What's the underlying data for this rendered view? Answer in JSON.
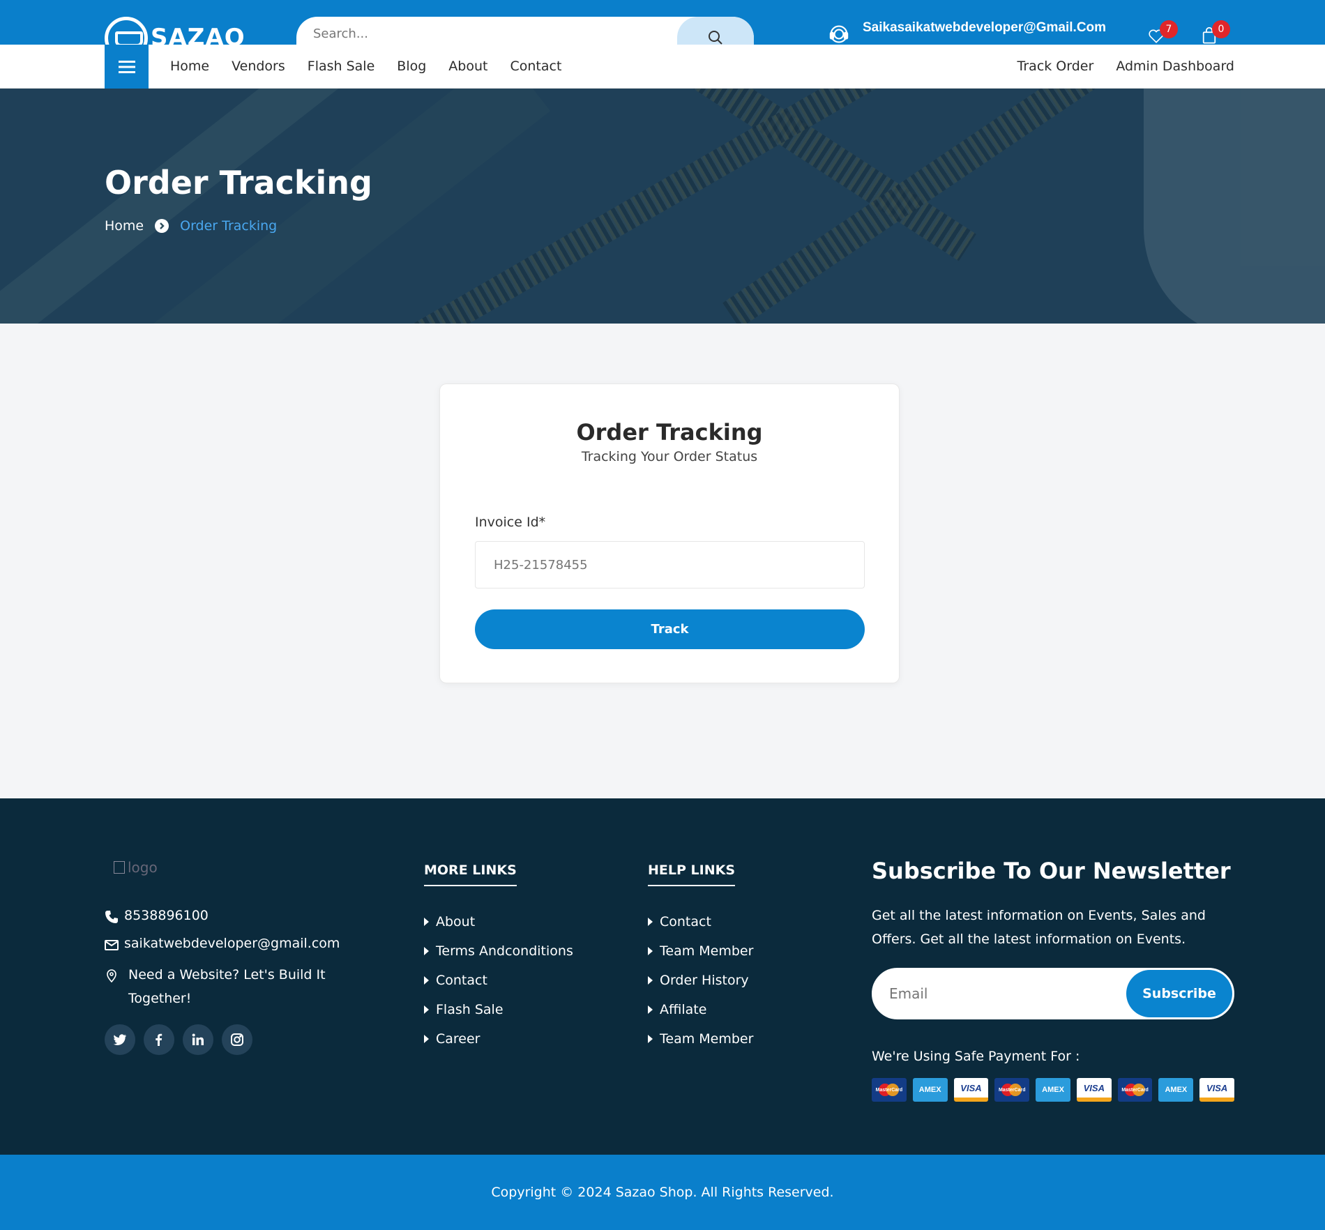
{
  "brand": {
    "name": "SAZAO",
    "primary_color": "#0a7fcb",
    "footer_color": "#0b2a3c"
  },
  "header": {
    "search_placeholder": "Search...",
    "email": "Saikasaikatwebdeveloper@Gmail.Com",
    "wishlist_count": "7",
    "cart_count": "0"
  },
  "nav": {
    "left": [
      "Home",
      "Vendors",
      "Flash Sale",
      "Blog",
      "About",
      "Contact"
    ],
    "right": [
      "Track Order",
      "Admin Dashboard"
    ]
  },
  "hero": {
    "title": "Order Tracking",
    "breadcrumb_home": "Home",
    "breadcrumb_current": "Order Tracking"
  },
  "tracking": {
    "title": "Order Tracking",
    "subtitle": "Tracking Your Order Status",
    "invoice_label": "Invoice Id*",
    "invoice_placeholder": "H25-21578455",
    "button": "Track"
  },
  "footer": {
    "logo_alt": "logo",
    "phone": "8538896100",
    "email": "saikatwebdeveloper@gmail.com",
    "address": "Need a Website? Let's Build It Together!",
    "more_links_title": "MORE LINKS",
    "more_links": [
      "About",
      "Terms Andconditions",
      "Contact",
      "Flash Sale",
      "Career"
    ],
    "help_links_title": "HELP LINKS",
    "help_links": [
      "Contact",
      "Team Member",
      "Order History",
      "Affilate",
      "Team Member"
    ],
    "newsletter_title": "Subscribe To Our Newsletter",
    "newsletter_text": "Get all the latest information on Events, Sales and Offers. Get all the latest information on Events.",
    "newsletter_placeholder": "Email",
    "subscribe_button": "Subscribe",
    "payment_label": "We're Using Safe Payment For :",
    "payment_methods": [
      {
        "type": "mc",
        "label": "MasterCard"
      },
      {
        "type": "amex",
        "label": "AMEX"
      },
      {
        "type": "visa",
        "label": "VISA"
      },
      {
        "type": "mc",
        "label": "MasterCard"
      },
      {
        "type": "amex",
        "label": "AMEX"
      },
      {
        "type": "visa",
        "label": "VISA"
      },
      {
        "type": "mc",
        "label": "MasterCard"
      },
      {
        "type": "amex",
        "label": "AMEX"
      },
      {
        "type": "visa",
        "label": "VISA"
      }
    ],
    "social_icons": [
      "twitter-icon",
      "facebook-icon",
      "linkedin-icon",
      "instagram-icon"
    ],
    "copyright": "Copyright © 2024 Sazao Shop. All Rights Reserved."
  }
}
